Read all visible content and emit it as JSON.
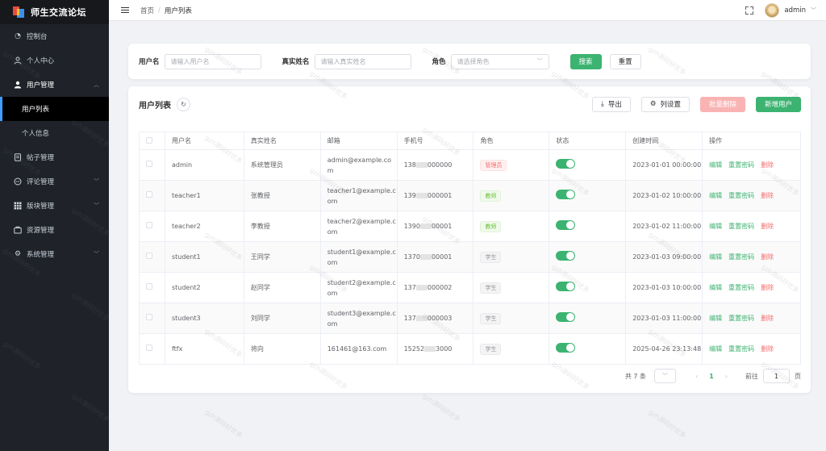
{
  "app": {
    "title": "师生交流论坛"
  },
  "sidebar": {
    "items": [
      {
        "label": "控制台",
        "icon": "dashboard-icon",
        "arrow": false
      },
      {
        "label": "个人中心",
        "icon": "user-icon",
        "arrow": false
      },
      {
        "label": "用户管理",
        "icon": "user-filled-icon",
        "arrow": true,
        "expanded": true,
        "children": [
          {
            "label": "用户列表",
            "active": true
          },
          {
            "label": "个人信息",
            "active": false
          }
        ]
      },
      {
        "label": "帖子管理",
        "icon": "document-icon",
        "arrow": false
      },
      {
        "label": "评论管理",
        "icon": "chat-icon",
        "arrow": true
      },
      {
        "label": "版块管理",
        "icon": "grid-icon",
        "arrow": true
      },
      {
        "label": "资源管理",
        "icon": "folder-icon",
        "arrow": false
      },
      {
        "label": "系统管理",
        "icon": "gear-icon",
        "arrow": true
      }
    ]
  },
  "header": {
    "breadcrumb": [
      "首页",
      "用户列表"
    ],
    "username": "admin"
  },
  "search": {
    "username_label": "用户名",
    "username_placeholder": "请输入用户名",
    "realname_label": "真实姓名",
    "realname_placeholder": "请输入真实姓名",
    "role_label": "角色",
    "role_placeholder": "请选择角色",
    "search_button": "搜索",
    "reset_button": "重置"
  },
  "table": {
    "title": "用户列表",
    "export_button": "导出",
    "columns_button": "列设置",
    "batch_delete_button": "批量删除",
    "add_button": "新增用户",
    "headers": [
      "用户名",
      "真实姓名",
      "邮箱",
      "手机号",
      "角色",
      "状态",
      "创建时间",
      "操作"
    ],
    "rows": [
      {
        "username": "admin",
        "realname": "系统管理员",
        "email": "admin@example.com",
        "phone_a": "138",
        "phone_b": "000000",
        "role": "管理员",
        "role_type": "admin",
        "status": true,
        "created": "2023-01-01 00:00:00"
      },
      {
        "username": "teacher1",
        "realname": "张教授",
        "email": "teacher1@example.com",
        "phone_a": "139",
        "phone_b": "000001",
        "role": "教师",
        "role_type": "teacher",
        "status": true,
        "created": "2023-01-02 10:00:00"
      },
      {
        "username": "teacher2",
        "realname": "李教授",
        "email": "teacher2@example.com",
        "phone_a": "1390",
        "phone_b": "00001",
        "role": "教师",
        "role_type": "teacher",
        "status": true,
        "created": "2023-01-02 11:00:00"
      },
      {
        "username": "student1",
        "realname": "王同学",
        "email": "student1@example.com",
        "phone_a": "1370",
        "phone_b": "00001",
        "role": "学生",
        "role_type": "student",
        "status": true,
        "created": "2023-01-03 09:00:00"
      },
      {
        "username": "student2",
        "realname": "赵同学",
        "email": "student2@example.com",
        "phone_a": "137",
        "phone_b": "000002",
        "role": "学生",
        "role_type": "student",
        "status": true,
        "created": "2023-01-03 10:00:00"
      },
      {
        "username": "student3",
        "realname": "刘同学",
        "email": "student3@example.com",
        "phone_a": "137",
        "phone_b": "000003",
        "role": "学生",
        "role_type": "student",
        "status": true,
        "created": "2023-01-03 11:00:00"
      },
      {
        "username": "ftfx",
        "realname": "将向",
        "email": "161461@163.com",
        "phone_a": "15252",
        "phone_b": "3000",
        "role": "学生",
        "role_type": "student",
        "status": true,
        "created": "2025-04-26 23:13:48"
      }
    ],
    "row_actions": [
      "编辑",
      "重置密码",
      "删除"
    ]
  },
  "pagination": {
    "total_text": "共 7 条",
    "current_page": "1",
    "goto_label": "前往",
    "goto_value": "1",
    "page_suffix": "页"
  },
  "watermark": "gzh源码好优多",
  "colors": {
    "primary": "#3cb371",
    "danger": "#f56c6c",
    "sidebar_bg": "#1f2329"
  }
}
